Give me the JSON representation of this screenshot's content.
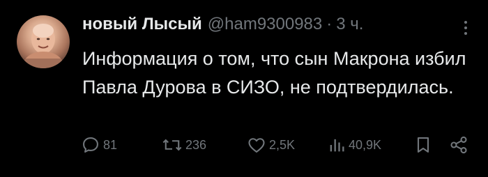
{
  "tweet": {
    "author_name": "новый Лысый",
    "handle": "@ham9300983",
    "separator": "·",
    "time": "3 ч.",
    "text": "Информация о том, что сын Макрона избил Павла Дурова в СИЗО, не подтвердилась."
  },
  "actions": {
    "replies": "81",
    "reposts": "236",
    "likes": "2,5K",
    "views": "40,9K"
  },
  "icons": {
    "more": "more-vertical-icon",
    "reply": "reply-icon",
    "repost": "repost-icon",
    "like": "heart-icon",
    "views": "views-icon",
    "bookmark": "bookmark-icon",
    "share": "share-icon"
  },
  "colors": {
    "background": "#000000",
    "text": "#e7e9ea",
    "secondary": "#71767b"
  }
}
